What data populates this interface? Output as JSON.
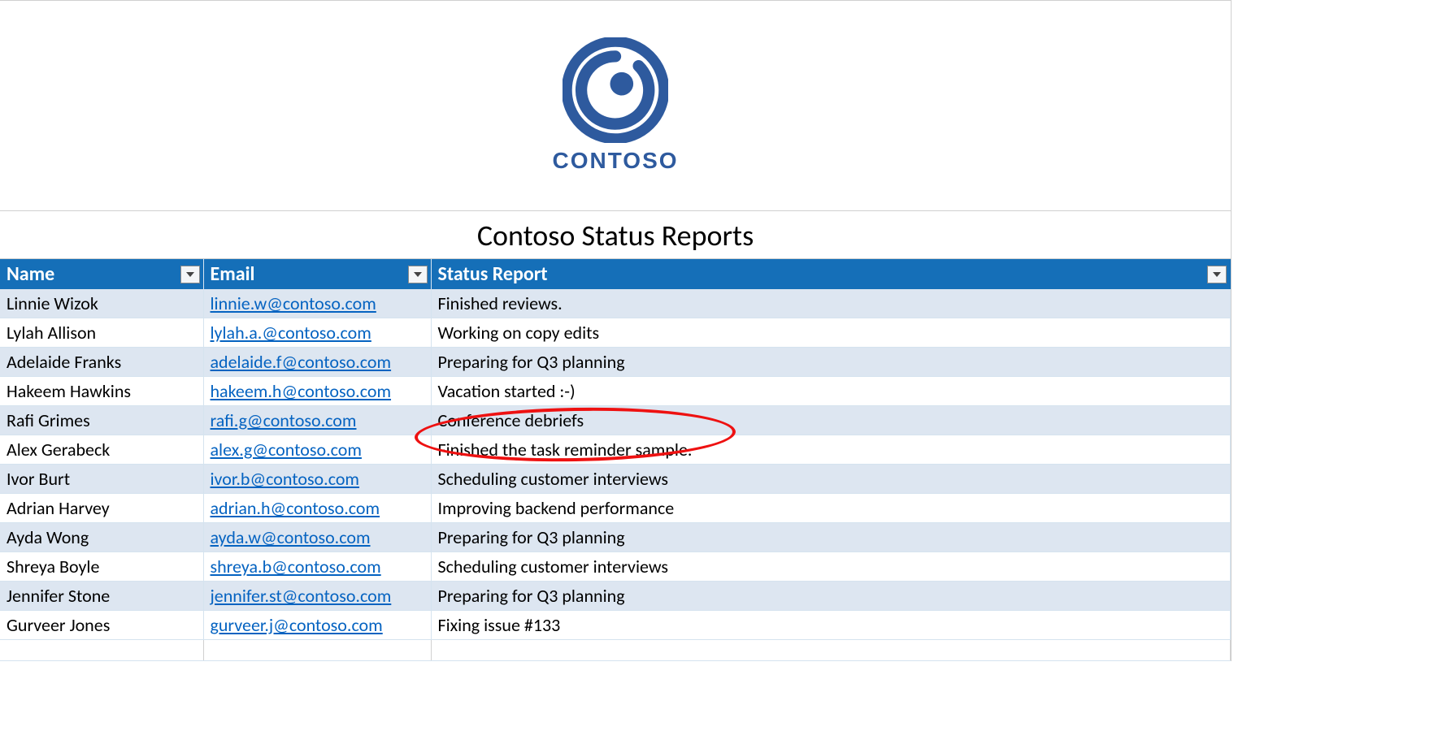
{
  "brand": {
    "name": "CONTOSO",
    "color": "#2e5a9e"
  },
  "title": "Contoso Status Reports",
  "columns": {
    "name": "Name",
    "email": "Email",
    "status": "Status Report"
  },
  "rows": [
    {
      "name": "Linnie Wizok",
      "email": "linnie.w@contoso.com",
      "status": "Finished reviews."
    },
    {
      "name": "Lylah Allison",
      "email": "lylah.a.@contoso.com",
      "status": "Working on copy edits"
    },
    {
      "name": "Adelaide Franks",
      "email": "adelaide.f@contoso.com",
      "status": "Preparing for Q3 planning"
    },
    {
      "name": "Hakeem Hawkins",
      "email": "hakeem.h@contoso.com",
      "status": "Vacation started :-)"
    },
    {
      "name": "Rafi Grimes",
      "email": "rafi.g@contoso.com",
      "status": "Conference debriefs"
    },
    {
      "name": "Alex Gerabeck",
      "email": "alex.g@contoso.com",
      "status": "Finished the task reminder sample."
    },
    {
      "name": "Ivor Burt",
      "email": "ivor.b@contoso.com",
      "status": "Scheduling customer interviews"
    },
    {
      "name": "Adrian Harvey",
      "email": "adrian.h@contoso.com",
      "status": "Improving backend performance"
    },
    {
      "name": "Ayda Wong",
      "email": "ayda.w@contoso.com",
      "status": "Preparing for Q3 planning"
    },
    {
      "name": "Shreya Boyle",
      "email": "shreya.b@contoso.com",
      "status": "Scheduling customer interviews"
    },
    {
      "name": "Jennifer Stone",
      "email": "jennifer.st@contoso.com",
      "status": "Preparing for Q3 planning"
    },
    {
      "name": "Gurveer Jones",
      "email": "gurveer.j@contoso.com",
      "status": "Fixing issue #133"
    }
  ],
  "annotation": {
    "kind": "red-ellipse",
    "target_row_index": 5,
    "target_column": "status"
  }
}
